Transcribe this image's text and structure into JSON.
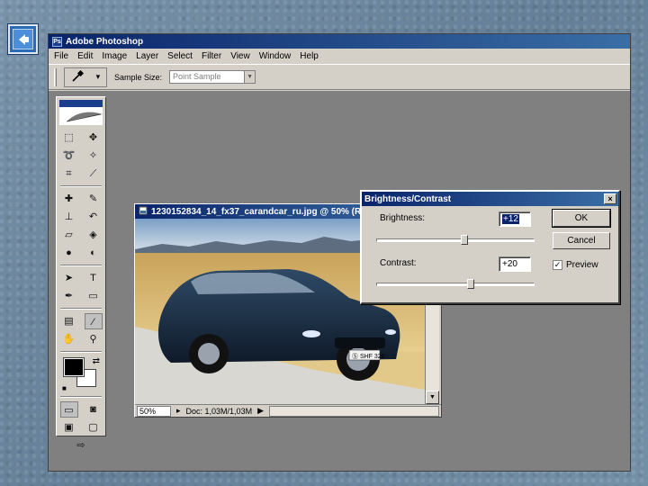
{
  "app": {
    "title": "Adobe Photoshop",
    "app_icon_label": "Ps",
    "back_icon": "back-arrow-icon"
  },
  "menu": [
    "File",
    "Edit",
    "Image",
    "Layer",
    "Select",
    "Filter",
    "View",
    "Window",
    "Help"
  ],
  "options_bar": {
    "sample_size_label": "Sample Size:",
    "sample_size_value": "Point Sample"
  },
  "toolbox": {
    "rows": [
      [
        "marquee-icon",
        "move-icon"
      ],
      [
        "lasso-icon",
        "magic-wand-icon"
      ],
      [
        "crop-icon",
        "slice-icon"
      ],
      [
        "healing-brush-icon",
        "brush-icon"
      ],
      [
        "clone-stamp-icon",
        "history-brush-icon"
      ],
      [
        "eraser-icon",
        "paint-bucket-icon"
      ],
      [
        "blur-icon",
        "dodge-icon"
      ],
      [
        "path-select-icon",
        "type-icon"
      ],
      [
        "pen-icon",
        "rectangle-icon"
      ],
      [
        "notes-icon",
        "eyedropper-icon"
      ],
      [
        "hand-icon",
        "zoom-icon"
      ]
    ],
    "colors": {
      "foreground": "#000000",
      "background": "#ffffff"
    }
  },
  "document": {
    "title": "1230152834_14_fx37_carandcar_ru.jpg @ 50% (RGB",
    "zoom": "50%",
    "doc_size": "Doc: 1,03M/1,03M",
    "license_plate": "Ⓢ SHF 320"
  },
  "dialog": {
    "title": "Brightness/Contrast",
    "brightness_label": "Brightness:",
    "brightness_value": "+12",
    "contrast_label": "Contrast:",
    "contrast_value": "+20",
    "ok_label": "OK",
    "cancel_label": "Cancel",
    "preview_label": "Preview",
    "preview_checked": true,
    "brightness_level": 12,
    "contrast_level": 20,
    "slider_range": [
      -100,
      100
    ]
  }
}
